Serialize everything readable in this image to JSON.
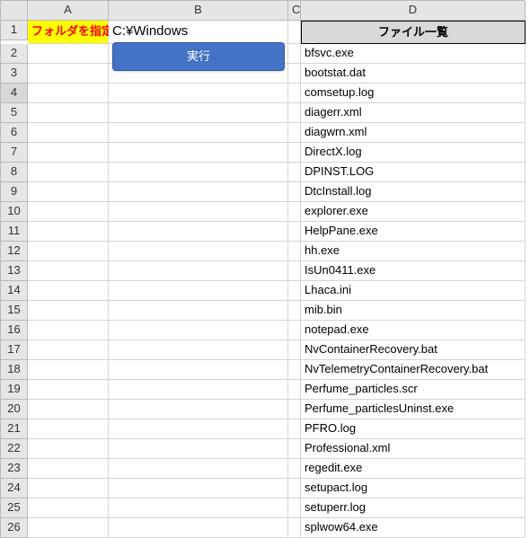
{
  "columns": [
    "A",
    "B",
    "C",
    "D"
  ],
  "a1_label": "フォルダを指定",
  "path_value": "C:¥Windows",
  "execute_label": "実行",
  "d1_header": "ファイル一覧",
  "files": [
    "bfsvc.exe",
    "bootstat.dat",
    "comsetup.log",
    "diagerr.xml",
    "diagwrn.xml",
    "DirectX.log",
    "DPINST.LOG",
    "DtcInstall.log",
    "explorer.exe",
    "HelpPane.exe",
    "hh.exe",
    "IsUn0411.exe",
    "Lhaca.ini",
    "mib.bin",
    "notepad.exe",
    "NvContainerRecovery.bat",
    "NvTelemetryContainerRecovery.bat",
    "Perfume_particles.scr",
    "Perfume_particlesUninst.exe",
    "PFRO.log",
    "Professional.xml",
    "regedit.exe",
    "setupact.log",
    "setuperr.log",
    "splwow64.exe"
  ],
  "row_count": 26,
  "selected_row": 4
}
